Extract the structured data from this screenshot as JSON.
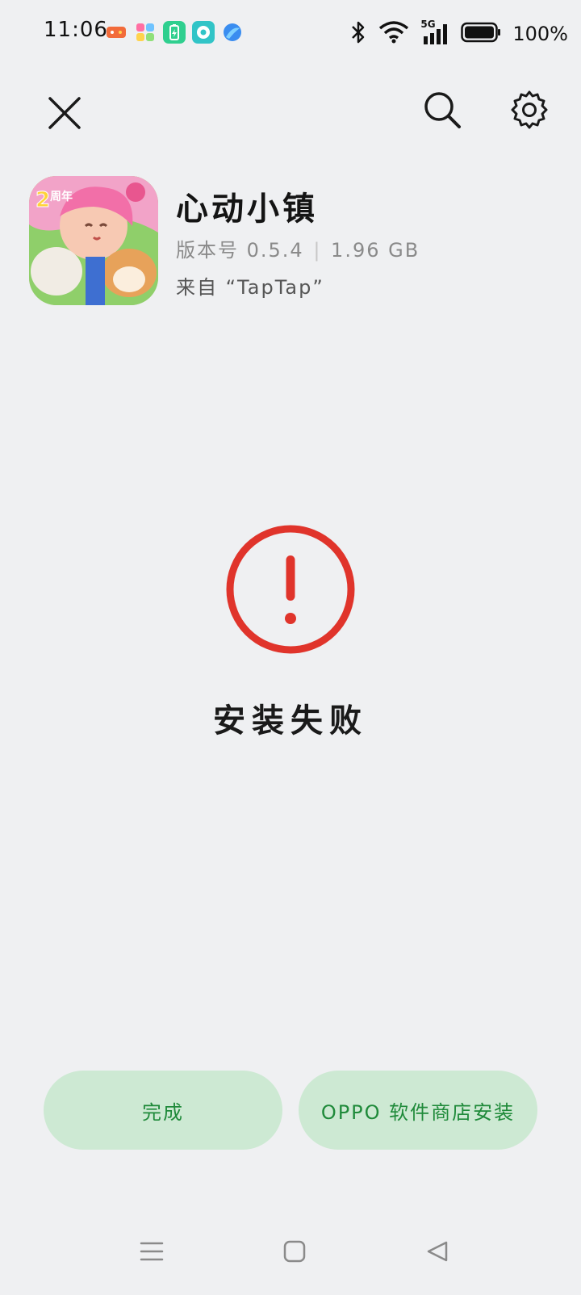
{
  "status_bar": {
    "time": "11:06",
    "battery_percent": "100%",
    "network": "5G",
    "icons": [
      "bluetooth-icon",
      "wifi-icon",
      "signal-icon",
      "battery-icon"
    ],
    "notification_icons": [
      "game-app-icon",
      "puzzle-app-icon",
      "battery-saver-icon",
      "screen-record-icon",
      "browser-icon"
    ]
  },
  "toolbar": {
    "icons": [
      "close-icon",
      "search-icon",
      "settings-icon"
    ]
  },
  "app": {
    "name": "心动小镇",
    "version_label": "版本号 0.5.4",
    "size": "1.96 GB",
    "source": "来自 “TapTap”",
    "icon_badge": "2周年"
  },
  "install": {
    "status": "安装失败",
    "status_color": "#e0342b"
  },
  "actions": {
    "done_label": "完成",
    "store_install_label": "OPPO 软件商店安装",
    "button_color": "#cde9d3",
    "text_color": "#1f8a3a"
  },
  "nav_bar": {
    "icons": [
      "menu-icon",
      "home-icon",
      "back-icon"
    ]
  }
}
